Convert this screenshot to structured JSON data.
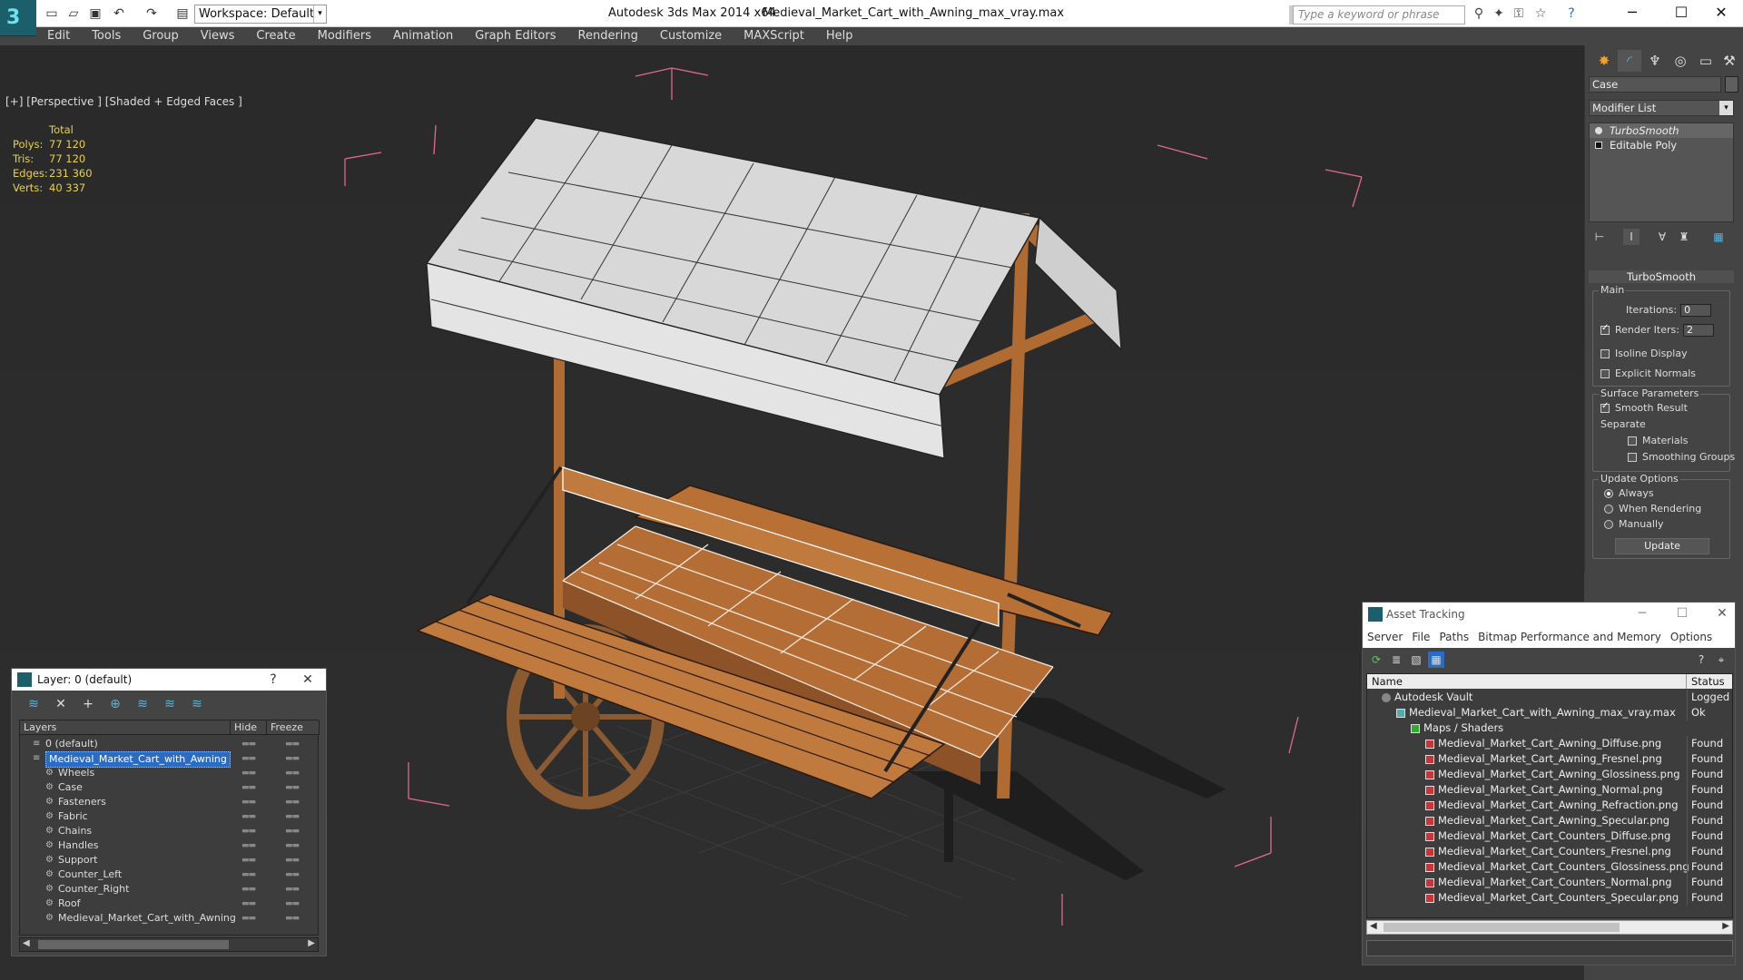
{
  "titlebar": {
    "workspace": "Workspace: Default",
    "app_title": "Autodesk 3ds Max 2014 x64",
    "file_title": "Medieval_Market_Cart_with_Awning_max_vray.max",
    "search_placeholder": "Type a keyword or phrase"
  },
  "menu": [
    "Edit",
    "Tools",
    "Group",
    "Views",
    "Create",
    "Modifiers",
    "Animation",
    "Graph Editors",
    "Rendering",
    "Customize",
    "MAXScript",
    "Help"
  ],
  "viewport": {
    "label": "[+] [Perspective ] [Shaded + Edged Faces ]",
    "stats_header": "Total",
    "stats": [
      {
        "label": "Polys:",
        "value": "77 120"
      },
      {
        "label": "Tris:",
        "value": "77 120"
      },
      {
        "label": "Edges:",
        "value": "231 360"
      },
      {
        "label": "Verts:",
        "value": "40 337"
      }
    ]
  },
  "command_panel": {
    "object_name": "Case",
    "modifier_list": "Modifier List",
    "stack": [
      "TurboSmooth",
      "Editable Poly"
    ],
    "rollout_title": "TurboSmooth",
    "main_label": "Main",
    "iterations_label": "Iterations:",
    "iterations_value": "0",
    "render_iters_label": "Render Iters:",
    "render_iters_value": "2",
    "isoline": "Isoline Display",
    "explicit_normals": "Explicit Normals",
    "surface_label": "Surface Parameters",
    "smooth_result": "Smooth Result",
    "separate": "Separate",
    "materials": "Materials",
    "smoothing_groups": "Smoothing Groups",
    "update_label": "Update Options",
    "always": "Always",
    "when_rendering": "When Rendering",
    "manually": "Manually",
    "update_button": "Update"
  },
  "layer_window": {
    "title": "Layer: 0 (default)",
    "col_layers": "Layers",
    "col_hide": "Hide",
    "col_freeze": "Freeze",
    "rows": [
      {
        "name": "0 (default)",
        "indent": 0,
        "selected": false
      },
      {
        "name": "Medieval_Market_Cart_with_Awning",
        "indent": 0,
        "selected": true
      },
      {
        "name": "Wheels",
        "indent": 1,
        "selected": false
      },
      {
        "name": "Case",
        "indent": 1,
        "selected": false
      },
      {
        "name": "Fasteners",
        "indent": 1,
        "selected": false
      },
      {
        "name": "Fabric",
        "indent": 1,
        "selected": false
      },
      {
        "name": "Chains",
        "indent": 1,
        "selected": false
      },
      {
        "name": "Handles",
        "indent": 1,
        "selected": false
      },
      {
        "name": "Support",
        "indent": 1,
        "selected": false
      },
      {
        "name": "Counter_Left",
        "indent": 1,
        "selected": false
      },
      {
        "name": "Counter_Right",
        "indent": 1,
        "selected": false
      },
      {
        "name": "Roof",
        "indent": 1,
        "selected": false
      },
      {
        "name": "Medieval_Market_Cart_with_Awning",
        "indent": 1,
        "selected": false
      }
    ]
  },
  "asset_window": {
    "title": "Asset Tracking",
    "menu": [
      "Server",
      "File",
      "Paths",
      "Bitmap Performance and Memory",
      "Options"
    ],
    "col_name": "Name",
    "col_status": "Status",
    "rows": [
      {
        "name": "Autodesk Vault",
        "status": "Logged Ou",
        "indent": 1,
        "kind": "vault"
      },
      {
        "name": "Medieval_Market_Cart_with_Awning_max_vray.max",
        "status": "Ok",
        "indent": 2,
        "kind": "max"
      },
      {
        "name": "Maps / Shaders",
        "status": "",
        "indent": 3,
        "kind": "maps"
      },
      {
        "name": "Medieval_Market_Cart_Awning_Diffuse.png",
        "status": "Found",
        "indent": 4,
        "kind": "file"
      },
      {
        "name": "Medieval_Market_Cart_Awning_Fresnel.png",
        "status": "Found",
        "indent": 4,
        "kind": "file"
      },
      {
        "name": "Medieval_Market_Cart_Awning_Glossiness.png",
        "status": "Found",
        "indent": 4,
        "kind": "file"
      },
      {
        "name": "Medieval_Market_Cart_Awning_Normal.png",
        "status": "Found",
        "indent": 4,
        "kind": "file"
      },
      {
        "name": "Medieval_Market_Cart_Awning_Refraction.png",
        "status": "Found",
        "indent": 4,
        "kind": "file"
      },
      {
        "name": "Medieval_Market_Cart_Awning_Specular.png",
        "status": "Found",
        "indent": 4,
        "kind": "file"
      },
      {
        "name": "Medieval_Market_Cart_Counters_Diffuse.png",
        "status": "Found",
        "indent": 4,
        "kind": "file"
      },
      {
        "name": "Medieval_Market_Cart_Counters_Fresnel.png",
        "status": "Found",
        "indent": 4,
        "kind": "file"
      },
      {
        "name": "Medieval_Market_Cart_Counters_Glossiness.png",
        "status": "Found",
        "indent": 4,
        "kind": "file"
      },
      {
        "name": "Medieval_Market_Cart_Counters_Normal.png",
        "status": "Found",
        "indent": 4,
        "kind": "file"
      },
      {
        "name": "Medieval_Market_Cart_Counters_Specular.png",
        "status": "Found",
        "indent": 4,
        "kind": "file"
      }
    ]
  },
  "colors": {
    "accent": "#2a6bc4",
    "stats": "#e8d14a",
    "bbox": "#e06a8a",
    "wood": "#b87034",
    "canvas": "#d8d8d8"
  }
}
